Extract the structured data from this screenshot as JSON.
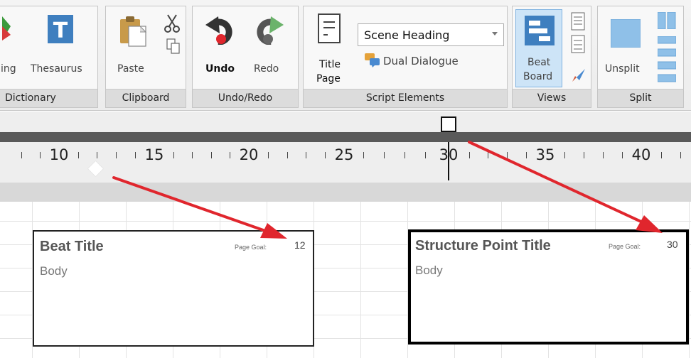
{
  "ribbon": {
    "groups": {
      "dictionary": "Dictionary",
      "clipboard": "Clipboard",
      "undo_redo": "Undo/Redo",
      "script_elements": "Script Elements",
      "views": "Views",
      "split": "Split"
    },
    "buttons": {
      "spelling_partial": "ing",
      "thesaurus": "Thesaurus",
      "paste": "Paste",
      "undo": "Undo",
      "redo": "Redo",
      "title_page_line1": "Title",
      "title_page_line2": "Page",
      "dual_dialogue": "Dual Dialogue",
      "beat_board_line1": "Beat",
      "beat_board_line2": "Board",
      "unsplit": "Unsplit"
    },
    "element_select": {
      "value": "Scene Heading"
    }
  },
  "ruler": {
    "ticks": [
      "10",
      "15",
      "20",
      "25",
      "30",
      "35",
      "40"
    ]
  },
  "cards": {
    "beat": {
      "title": "Beat Title",
      "body": "Body",
      "goal_label": "Page Goal:",
      "goal_value": "12"
    },
    "structure": {
      "title": "Structure Point Title",
      "body": "Body",
      "goal_label": "Page Goal:",
      "goal_value": "30"
    }
  },
  "colors": {
    "annotation_arrow": "#e0262d",
    "ribbon_active": "#cde4f7",
    "ribbon_bg": "#f0f0f0"
  }
}
